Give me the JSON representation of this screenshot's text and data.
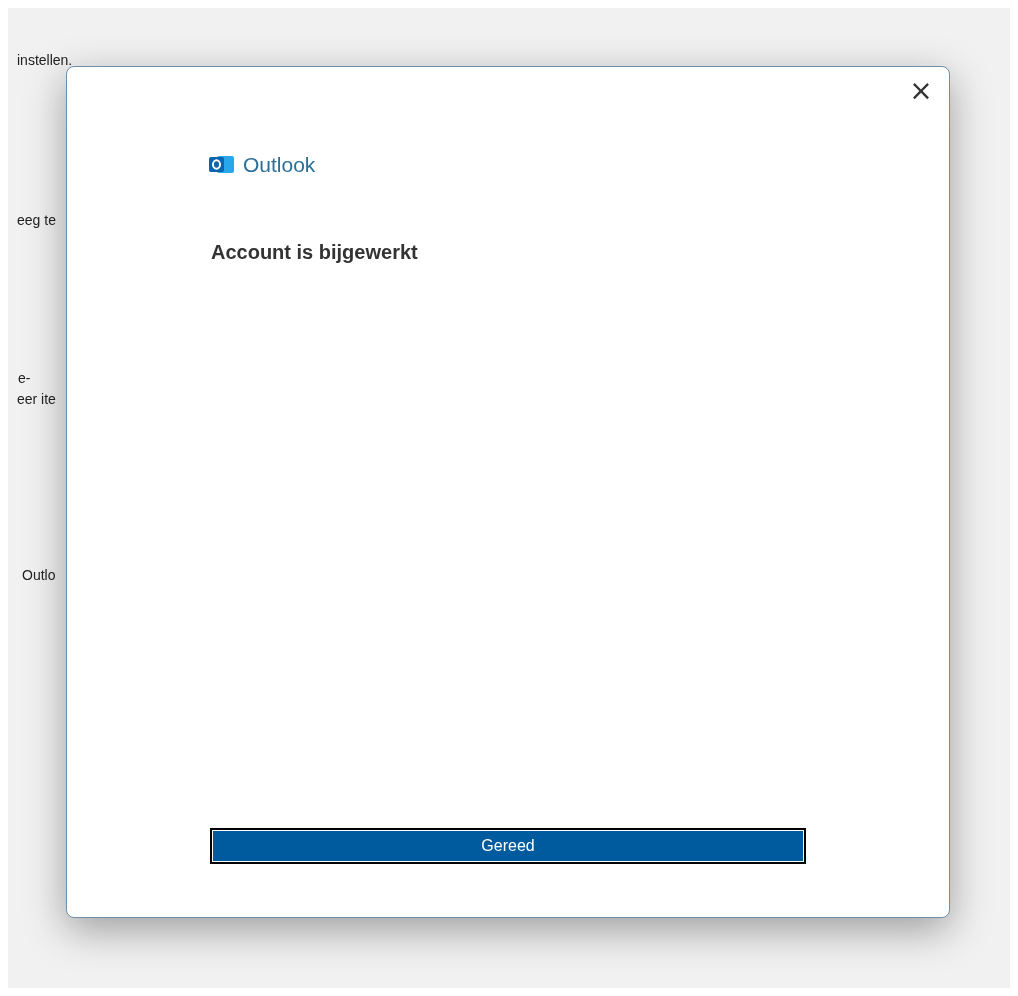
{
  "background_texts": [
    "instellen.",
    "eeg te",
    "e-",
    "eer ite",
    "Outlo"
  ],
  "dialog": {
    "close": "×",
    "app_name": "Outlook",
    "heading": "Account is bijgewerkt",
    "button": "Gereed"
  }
}
